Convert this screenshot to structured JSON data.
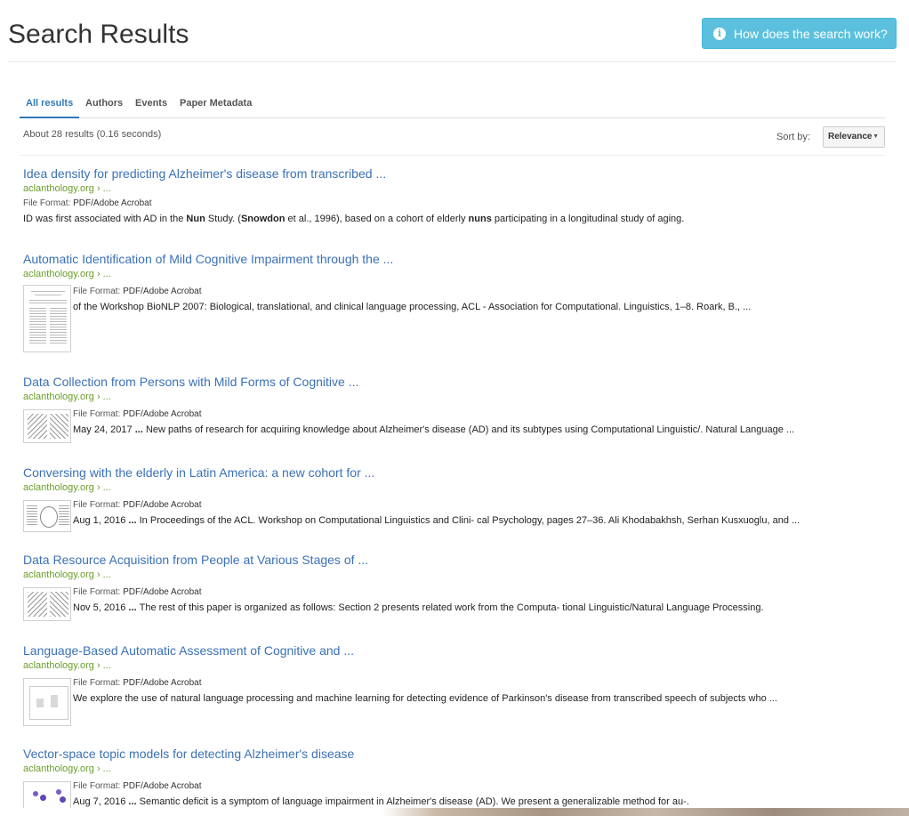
{
  "header": {
    "title": "Search Results",
    "help_button": "How does the search work?",
    "help_icon": "info-circle-icon"
  },
  "tabs": [
    "All results",
    "Authors",
    "Events",
    "Paper Metadata"
  ],
  "results_count": "About 28 results (0.16 seconds)",
  "sort": {
    "label": "Sort by:",
    "value": "Relevance"
  },
  "file_format_label": "File Format:",
  "results": [
    {
      "title": "Idea density for predicting Alzheimer's disease from transcribed ...",
      "url": "aclanthology.org › ...",
      "file_format": "PDF/Adobe Acrobat",
      "snippet_parts": [
        "ID was first associated with AD in the ",
        "Nun",
        " Study. (",
        "Snowdon",
        " et al., 1996), based on a cohort of elderly ",
        "nuns",
        " participating in a longitudinal study of aging."
      ]
    },
    {
      "title": "Automatic Identification of Mild Cognitive Impairment through the ...",
      "url": "aclanthology.org › ...",
      "file_format": "PDF/Adobe Acrobat",
      "date": "",
      "snippet": "of the Workshop BioNLP 2007: Biological, translational, and clinical language processing, ACL - Association for Computational. Linguistics, 1–8. Roark, B., ..."
    },
    {
      "title": "Data Collection from Persons with Mild Forms of Cognitive ...",
      "url": "aclanthology.org › ...",
      "file_format": "PDF/Adobe Acrobat",
      "date": "May 24, 2017",
      "ellipsis": " ... ",
      "snippet": "New paths of research for acquiring knowledge about Alzheimer's disease (AD) and its subtypes using Computational Linguistic/. Natural Language ..."
    },
    {
      "title": "Conversing with the elderly in Latin America: a new cohort for ...",
      "url": "aclanthology.org › ...",
      "file_format": "PDF/Adobe Acrobat",
      "date": "Aug 1, 2016",
      "ellipsis": " ... ",
      "snippet": "In Proceedings of the ACL. Workshop on Computational Linguistics and Clini- cal Psychology, pages 27–36. Ali Khodabakhsh, Serhan Kusxuoglu, and ..."
    },
    {
      "title": "Data Resource Acquisition from People at Various Stages of ...",
      "url": "aclanthology.org › ...",
      "file_format": "PDF/Adobe Acrobat",
      "date": "Nov 5, 2016",
      "ellipsis": " ... ",
      "snippet": "The rest of this paper is organized as follows: Section 2 presents related work from the Computa- tional Linguistic/Natural Language Processing."
    },
    {
      "title": "Language-Based Automatic Assessment of Cognitive and ...",
      "url": "aclanthology.org › ...",
      "file_format": "PDF/Adobe Acrobat",
      "date": "",
      "snippet": "We explore the use of natural language processing and machine learning for detecting evidence of Parkinson's disease from transcribed speech of subjects who ..."
    },
    {
      "title": "Vector-space topic models for detecting Alzheimer's disease",
      "url": "aclanthology.org › ...",
      "file_format": "PDF/Adobe Acrobat",
      "date": "Aug 7, 2016",
      "ellipsis": " ... ",
      "snippet": "Semantic deficit is a symptom of language impairment in Alzheimer's disease (AD). We present a generalizable method for au-."
    }
  ],
  "colors": {
    "link": "#3b71b6",
    "url": "#6a9e2a",
    "help_button_bg": "#5bc0de",
    "active_tab": "#337ab7"
  }
}
